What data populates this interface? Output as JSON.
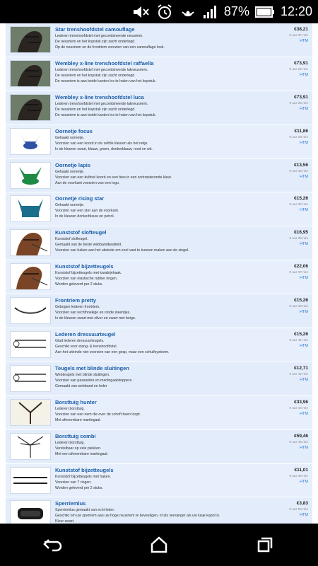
{
  "status": {
    "battery": "87%",
    "time": "12:20"
  },
  "items": [
    {
      "title": "Star trenshoofdstel camouflage",
      "lines": [
        "Lederen trenshoofdstel met gecombineerde neusriem.",
        "De neusriem en het kopstuk zijn zacht onderlegd.",
        "Op de neusriem en de frontriem voorzien van een camouflage look."
      ],
      "price": "€38,21",
      "stock": "9 uur 37 min",
      "link": "HTM",
      "thumb": "horse"
    },
    {
      "title": "Wembley x-line trenshoofdstel raffaella",
      "lines": [
        "Lederen trenshoofdstel met gecombineerde lakneusriem.",
        "De neusriem en het kopstuk zijn zacht onderlegd.",
        "De neusriem is aan beide kanten los te halen van het kopstuk."
      ],
      "price": "€73,91",
      "stock": "9 uur 22 min",
      "link": "HTM",
      "thumb": "horse"
    },
    {
      "title": "Wembley x-line trenshoofdstel luca",
      "lines": [
        "Lederen trenshoofdstel met gecombineerde lakneusriem.",
        "De neusriem en het kopstuk zijn zacht onderlegd.",
        "De neusriem is aan beide kanten los te halen van het kopstuk."
      ],
      "price": "€73,91",
      "stock": "9 uur 25 min",
      "link": "HTM",
      "thumb": "horse"
    },
    {
      "title": "Oornetje focus",
      "lines": [
        "Gehaakt oornetje.",
        "Voorzien van een koord in de zelfde kleuren als het netje.",
        "In de kleuren zwart, blauw, groen, donkerblauw, rood en wit."
      ],
      "price": "€11,86",
      "stock": "9 uur 28 min",
      "link": "HTM",
      "thumb": "bonnet-blue"
    },
    {
      "title": "Oornetje lapis",
      "lines": [
        "Gehaakt oornetje.",
        "Voorzien van een dubbel koord en een bies in een contrasterende kleur.",
        "Aan de voorkant voorzien van een logo."
      ],
      "price": "€13,56",
      "stock": "9 uur 30 min",
      "link": "HTM",
      "thumb": "bonnet-green"
    },
    {
      "title": "Oornetje rising star",
      "lines": [
        "Gehaakt oornetje.",
        "Voorzien van een ster aan de voorkant.",
        "In de kleuren donkerblauw en petrol."
      ],
      "price": "€15,26",
      "stock": "9 uur 32 min",
      "link": "HTM",
      "thumb": "bonnet-teal"
    },
    {
      "title": "Kunststof slofteugel",
      "lines": [
        "Kunststof slofteugel.",
        "Gemaakt van de beste webbandkwaliteit.",
        "Voorzien van haken aan het uiteinde om snel vast te kunnen maken aan de singel."
      ],
      "price": "€16,95",
      "stock": "9 uur 35 min",
      "link": "HTM",
      "thumb": "horse-brown"
    },
    {
      "title": "Kunststof bijzetteugels",
      "lines": [
        "Kunststof bijzetteugels met karabijnhaak.",
        "Voorzien van elastische rubber ringen.",
        "Worden geleverd per 2 stuks."
      ],
      "price": "€22,06",
      "stock": "9 uur 37 min",
      "link": "HTM",
      "thumb": "horse-brown"
    },
    {
      "title": "Frontriem pretty",
      "lines": [
        "Gebogen lederen frontriem.",
        "Voorzien van rechthoekige en ronde steentjes.",
        "In de kleuren zwart met zilver en zwart met beige."
      ],
      "price": "€15,26",
      "stock": "9 uur 39 min",
      "link": "HTM",
      "thumb": "strap"
    },
    {
      "title": "Lederen dressuurteugel",
      "lines": [
        "Glad lederen dressuurteugels.",
        "Geschikt voor stang- & trenshoofdstel.",
        "Aan het uiteinde niet voorzien van een gesp, maar een schuifsysteem."
      ],
      "price": "€15,26",
      "stock": "9 uur 41 min",
      "link": "HTM",
      "thumb": "rein"
    },
    {
      "title": "Teugels met blinde sluitingen",
      "lines": [
        "Webteugels met blinde sluitingen.",
        "Voorzien van passanten en martingaalstoppers.",
        "Gemaakt van webband en leder"
      ],
      "price": "€12,71",
      "stock": "9 uur 42 min",
      "link": "HTM",
      "thumb": "rein"
    },
    {
      "title": "Borsttuig hunter",
      "lines": [
        "Lederen borsttuig.",
        "Voorzien van een riem die over de schoft heen loopt.",
        "Met afneembare martingaal."
      ],
      "price": "€33,96",
      "stock": "9 uur 44 min",
      "link": "HTM",
      "thumb": "breast"
    },
    {
      "title": "Borsttuig combi",
      "lines": [
        "Lederen borsttuig.",
        "Verstelbaar op vele plekken.",
        "Met een afneembare martingaal."
      ],
      "price": "€59,46",
      "stock": "9 uur 46 min",
      "link": "HTM",
      "thumb": "breast-y"
    },
    {
      "title": "Kunststof bijzetteugels",
      "lines": [
        "Kunststof bijzetteugels met haken.",
        "Voorzien van 7 ringen.",
        "Worden geleverd per 2 stuks."
      ],
      "price": "€11,01",
      "stock": "9 uur 48 min",
      "link": "HTM",
      "thumb": "strap2"
    },
    {
      "title": "Sperriemlus",
      "lines": [
        "Sperriemlus gemaakt van echt leder.",
        "Geschikt om uw sperriem aan uw hoge neusriem te bevestigen, of als vervanger als uw lusje kapot is.",
        "Kleur zwart."
      ],
      "price": "€3,83",
      "stock": "9 uur 50 min",
      "link": "HTM",
      "thumb": "loop"
    }
  ]
}
